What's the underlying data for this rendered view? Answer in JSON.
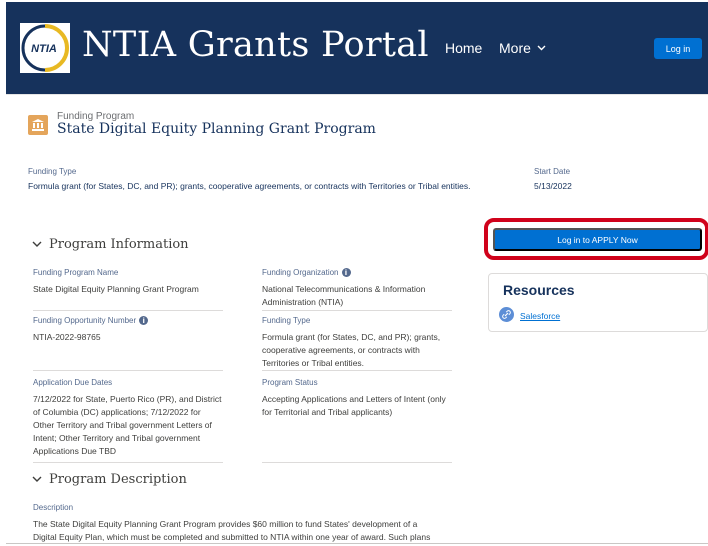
{
  "header": {
    "logo_text": "NTIA",
    "site_title": "NTIA Grants Portal",
    "nav_home": "Home",
    "nav_more": "More",
    "login_label": "Log in"
  },
  "record": {
    "kicker": "Funding Program",
    "title": "State Digital Equity Planning Grant Program"
  },
  "highlights": {
    "funding_type_label": "Funding Type",
    "funding_type_value": "Formula grant (for States, DC, and PR); grants, cooperative agreements, or contracts with Territories or Tribal entities.",
    "start_date_label": "Start Date",
    "start_date_value": "5/13/2022"
  },
  "program_info": {
    "heading": "Program Information",
    "program_name_label": "Funding Program Name",
    "program_name_value": "State Digital Equity Planning Grant Program",
    "org_label": "Funding Organization",
    "org_value": "National Telecommunications & Information Administration (NTIA)",
    "opp_number_label": "Funding Opportunity Number",
    "opp_number_value": "NTIA-2022-98765",
    "type_label": "Funding Type",
    "type_value": "Formula grant (for States, DC, and PR); grants, cooperative agreements, or contracts with Territories or Tribal entities.",
    "due_label": "Application Due Dates",
    "due_value": "7/12/2022 for State, Puerto Rico (PR), and District of Columbia (DC) applications; 7/12/2022 for Other Territory and Tribal government Letters of Intent; Other Territory and Tribal government Applications Due TBD",
    "status_label": "Program Status",
    "status_value": "Accepting Applications and Letters of Intent (only for Territorial and Tribal applicants)"
  },
  "program_description": {
    "heading": "Program Description",
    "desc_label": "Description",
    "desc_value": "The State Digital Equity Planning Grant Program provides $60 million to fund States' development of a Digital Equity Plan, which must be completed and submitted to NTIA within one year of award. Such plans"
  },
  "apply": {
    "label": "Log in to APPLY Now"
  },
  "resources": {
    "title": "Resources",
    "link_label": "Salesforce"
  },
  "colors": {
    "header_bg": "#16325c",
    "brand_blue": "#0070d2",
    "highlight_red": "#d0021b",
    "record_icon": "#e4a55b"
  }
}
